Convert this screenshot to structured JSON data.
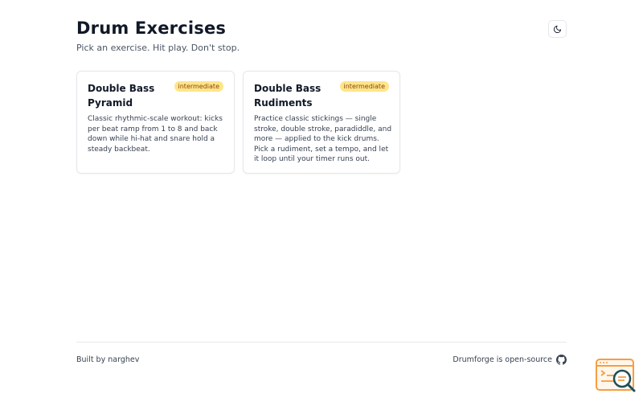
{
  "header": {
    "title": "Drum Exercises",
    "subtitle": "Pick an exercise. Hit play. Don't stop.",
    "theme_toggle_icon": "moon-icon"
  },
  "cards": [
    {
      "title": "Double Bass Pyramid",
      "level": "intermediate",
      "description": "Classic rhythmic-scale workout: kicks per beat ramp from 1 to 8 and back down while hi-hat and snare hold a steady backbeat."
    },
    {
      "title": "Double Bass Rudiments",
      "level": "intermediate",
      "description": "Practice classic stickings — single stroke, double stroke, paradiddle, and more — applied to the kick drums. Pick a rudiment, set a tempo, and let it loop until your timer runs out."
    }
  ],
  "footer": {
    "left_text": "Built by narghev",
    "right_text": "Drumforge is open-source",
    "right_icon": "github-icon"
  },
  "colors": {
    "badge_bg": "#fde68a",
    "badge_text": "#92400e",
    "logo_accent": "#f59e42",
    "logo_dark": "#1f4e5a"
  }
}
